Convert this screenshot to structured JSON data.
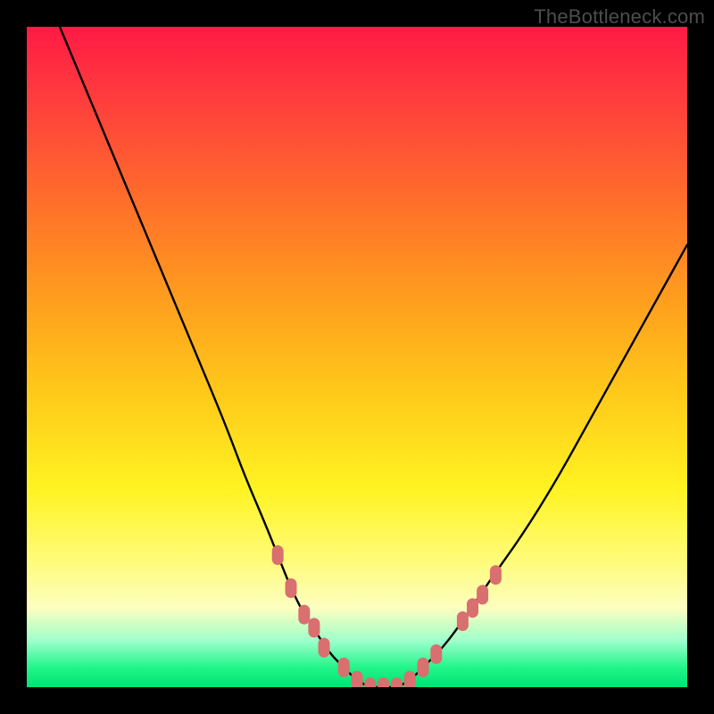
{
  "watermark": {
    "text": "TheBottleneck.com"
  },
  "colors": {
    "frame": "#000000",
    "curve": "#000000",
    "marker": "#d96f6e",
    "gradient_top": "#ff1a44",
    "gradient_bottom": "#00e374"
  },
  "chart_data": {
    "type": "line",
    "title": "",
    "xlabel": "",
    "ylabel": "",
    "xlim": [
      0,
      100
    ],
    "ylim": [
      0,
      100
    ],
    "grid": false,
    "legend": false,
    "series": [
      {
        "name": "bottleneck-curve",
        "x": [
          5,
          10,
          15,
          20,
          25,
          30,
          33,
          36,
          38,
          40,
          42,
          44,
          46,
          48,
          50,
          52,
          54,
          56,
          58,
          60,
          63,
          66,
          70,
          75,
          80,
          85,
          90,
          95,
          100
        ],
        "y": [
          100,
          88,
          76,
          64,
          52,
          40,
          32,
          25,
          20,
          15,
          11,
          8,
          5,
          3,
          1,
          0,
          0,
          0,
          1,
          3,
          6,
          10,
          16,
          23,
          31,
          40,
          49,
          58,
          67
        ]
      }
    ],
    "markers": [
      {
        "name": "highlighted-points",
        "shape": "rounded-rect",
        "color": "#d96f6e",
        "points": [
          {
            "x": 38,
            "y": 20
          },
          {
            "x": 40,
            "y": 15
          },
          {
            "x": 42,
            "y": 11
          },
          {
            "x": 43.5,
            "y": 9
          },
          {
            "x": 45,
            "y": 6
          },
          {
            "x": 48,
            "y": 3
          },
          {
            "x": 50,
            "y": 1
          },
          {
            "x": 52,
            "y": 0
          },
          {
            "x": 54,
            "y": 0
          },
          {
            "x": 56,
            "y": 0
          },
          {
            "x": 58,
            "y": 1
          },
          {
            "x": 60,
            "y": 3
          },
          {
            "x": 62,
            "y": 5
          },
          {
            "x": 66,
            "y": 10
          },
          {
            "x": 67.5,
            "y": 12
          },
          {
            "x": 69,
            "y": 14
          },
          {
            "x": 71,
            "y": 17
          }
        ]
      }
    ],
    "annotations": []
  }
}
